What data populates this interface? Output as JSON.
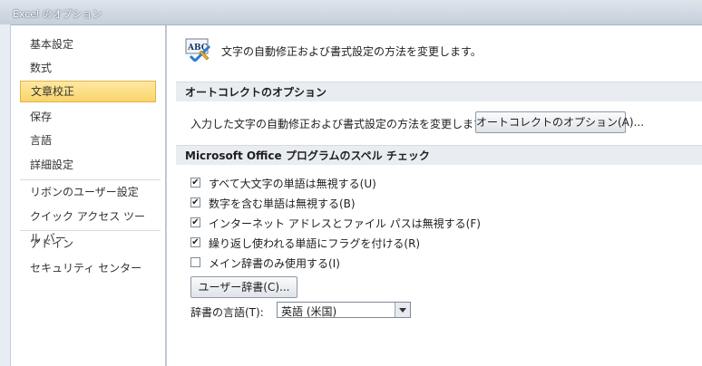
{
  "window": {
    "title": "Excel のオプション"
  },
  "nav": {
    "items": [
      "基本設定",
      "数式",
      "文章校正",
      "保存",
      "言語",
      "詳細設定",
      "リボンのユーザー設定",
      "クイック アクセス ツール バー",
      "アドイン",
      "セキュリティ センター"
    ],
    "selected": "文章校正"
  },
  "header": {
    "icon": "abc-check-icon",
    "text": "文字の自動修正および書式設定の方法を変更します。"
  },
  "autocorrect": {
    "heading": "オートコレクトのオプション",
    "description": "入力した文字の自動修正および書式設定の方法を変更します:",
    "button": "オートコレクトのオプション(A)..."
  },
  "spell": {
    "heading": "Microsoft Office プログラムのスペル チェック",
    "options": [
      {
        "label": "すべて大文字の単語は無視する(U)",
        "checked": true
      },
      {
        "label": "数字を含む単語は無視する(B)",
        "checked": true
      },
      {
        "label": "インターネット アドレスとファイル パスは無視する(F)",
        "checked": true
      },
      {
        "label": "繰り返し使われる単語にフラグを付ける(R)",
        "checked": true
      },
      {
        "label": "メイン辞書のみ使用する(I)",
        "checked": false
      }
    ],
    "dictionary_button": "ユーザー辞書(C)...",
    "language_label": "辞書の言語(T):",
    "language_value": "英語 (米国)"
  },
  "colors": {
    "selected_bg": "#f9d46b",
    "section_bg": "#e9edf2"
  }
}
